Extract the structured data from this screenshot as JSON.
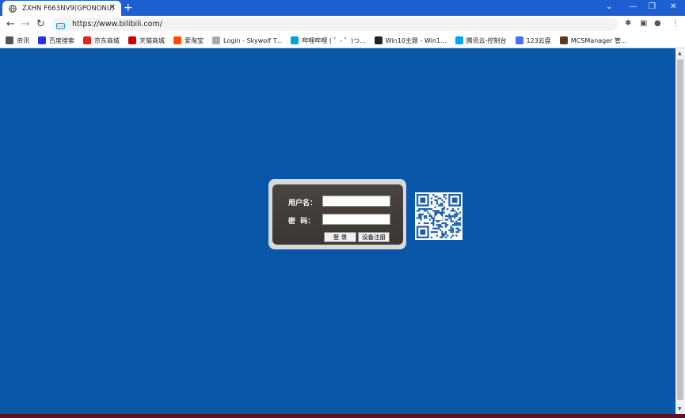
{
  "browser": {
    "tab_title": "ZXHN F663NV9(GPONONU)",
    "url": "https://www.bilibili.com/",
    "accent": "#1d5fd0"
  },
  "bookmarks": [
    {
      "label": "资讯",
      "icon": "globe-icon",
      "color": "#555555"
    },
    {
      "label": "百度搜索",
      "icon": "baidu-paw-icon",
      "color": "#2932e1"
    },
    {
      "label": "京东商城",
      "icon": "jd-icon",
      "color": "#e1251b"
    },
    {
      "label": "天猫商城",
      "icon": "tmall-icon",
      "color": "#d00000"
    },
    {
      "label": "爱淘宝",
      "icon": "taobao-icon",
      "color": "#ff5000"
    },
    {
      "label": "Login - Skywolf T...",
      "icon": "skywolf-icon",
      "color": "#aaaaaa"
    },
    {
      "label": "哔哩哔哩 ( ゜- ゜)つ...",
      "icon": "bilibili-tv-icon",
      "color": "#00a1d6"
    },
    {
      "label": "Win10主题 - Win1...",
      "icon": "x-icon",
      "color": "#222222"
    },
    {
      "label": "腾讯云-控制台",
      "icon": "cloud-icon",
      "color": "#00a4ff"
    },
    {
      "label": "123云盘",
      "icon": "123pan-icon",
      "color": "#4b6ef5"
    },
    {
      "label": "MCSManager 管...",
      "icon": "mcs-block-icon",
      "color": "#5a3a1a"
    }
  ],
  "login": {
    "username_label": "用户名：",
    "password_label": "密  码：",
    "username_value": "",
    "password_value": "",
    "login_button": "登 录",
    "register_button": "设备注册"
  },
  "page": {
    "background_color": "#0a56a8",
    "qr_icon": "qr-code-icon"
  }
}
